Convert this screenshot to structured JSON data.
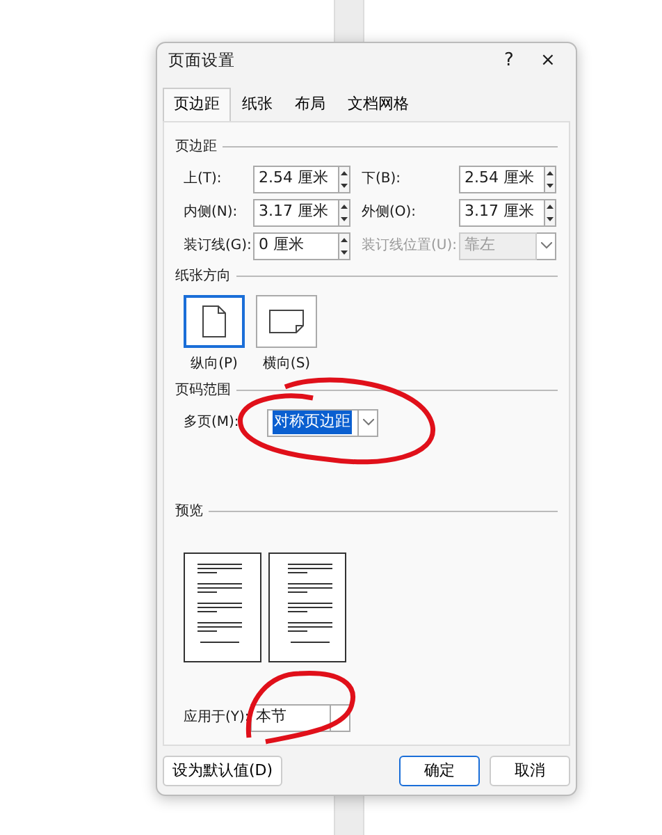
{
  "window": {
    "title": "页面设置",
    "help": "?",
    "close": "×"
  },
  "tabs": [
    {
      "label": "页边距",
      "selected": true
    },
    {
      "label": "纸张",
      "selected": false
    },
    {
      "label": "布局",
      "selected": false
    },
    {
      "label": "文档网格",
      "selected": false
    }
  ],
  "margins": {
    "heading": "页边距",
    "fields": [
      {
        "label": "上(T):",
        "value": "2.54 厘米",
        "kind": "spin",
        "disabled": false
      },
      {
        "label": "下(B):",
        "value": "2.54 厘米",
        "kind": "spin",
        "disabled": false
      },
      {
        "label": "内侧(N):",
        "value": "3.17 厘米",
        "kind": "spin",
        "disabled": false
      },
      {
        "label": "外侧(O):",
        "value": "3.17 厘米",
        "kind": "spin",
        "disabled": false
      },
      {
        "label": "装订线(G):",
        "value": "0 厘米",
        "kind": "spin",
        "disabled": false
      },
      {
        "label": "装订线位置(U):",
        "value": "靠左",
        "kind": "select",
        "disabled": true
      }
    ]
  },
  "orientation": {
    "heading": "纸张方向",
    "options": [
      {
        "label": "纵向(P)",
        "kind": "portrait",
        "selected": true
      },
      {
        "label": "横向(S)",
        "kind": "landscape",
        "selected": false
      }
    ]
  },
  "pages": {
    "heading": "页码范围",
    "label": "多页(M):",
    "value": "对称页边距",
    "highlighted": true
  },
  "preview": {
    "heading": "预览"
  },
  "apply": {
    "label": "应用于(Y):",
    "value": "本节"
  },
  "buttons": [
    {
      "label": "设为默认值(D)",
      "kind": "left",
      "default": false
    },
    {
      "label": "确定",
      "kind": "right",
      "default": true
    },
    {
      "label": "取消",
      "kind": "right",
      "default": false
    }
  ]
}
